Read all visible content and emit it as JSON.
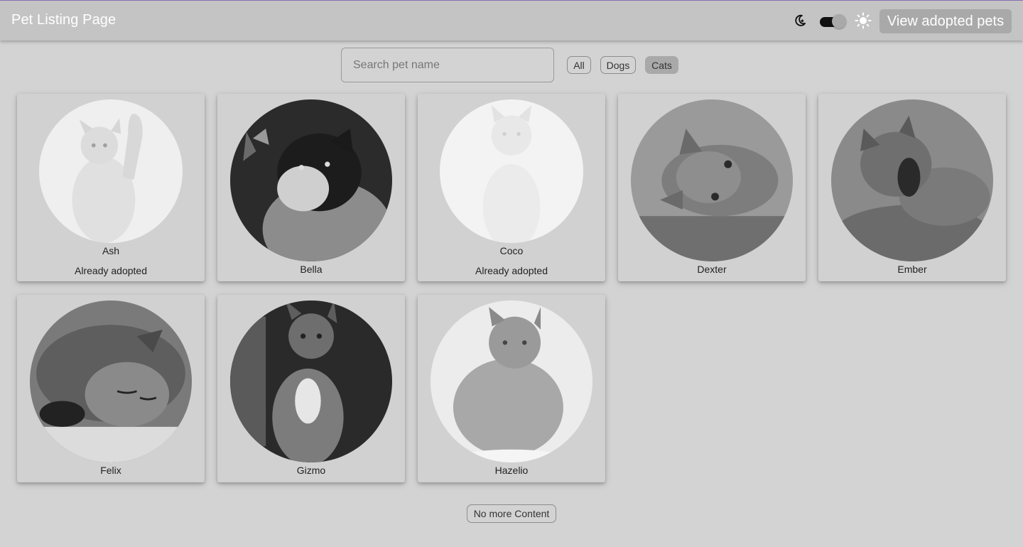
{
  "appbar": {
    "title": "Pet Listing Page",
    "theme_toggle": {
      "dark_icon": "moon-icon",
      "light_icon": "sun-icon",
      "state": "light"
    },
    "adopted_button_label": "View adopted pets"
  },
  "search": {
    "placeholder": "Search pet name",
    "value": ""
  },
  "filters": {
    "selected": "Cats",
    "chips": [
      "All",
      "Dogs",
      "Cats"
    ]
  },
  "pets": [
    {
      "name": "Ash",
      "status": "Already adopted",
      "photo_tone": "light"
    },
    {
      "name": "Bella",
      "status": "",
      "photo_tone": "dark"
    },
    {
      "name": "Coco",
      "status": "Already adopted",
      "photo_tone": "light"
    },
    {
      "name": "Dexter",
      "status": "",
      "photo_tone": "mid"
    },
    {
      "name": "Ember",
      "status": "",
      "photo_tone": "mid"
    },
    {
      "name": "Felix",
      "status": "",
      "photo_tone": "mid"
    },
    {
      "name": "Gizmo",
      "status": "",
      "photo_tone": "dark"
    },
    {
      "name": "Hazelio",
      "status": "",
      "photo_tone": "light"
    }
  ],
  "footer": {
    "end_label": "No more Content"
  },
  "colors": {
    "background": "#d3d3d3",
    "appbar": "#c4c4c4",
    "accent_button": "#a9a9a9",
    "top_border": "#8a6fb3"
  }
}
